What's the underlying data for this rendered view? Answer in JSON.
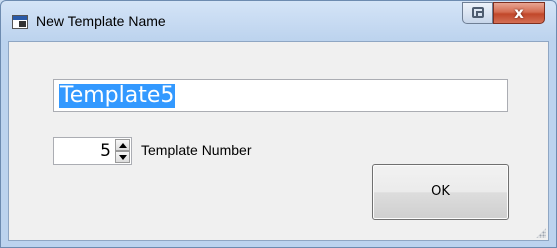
{
  "window": {
    "title": "New Template Name",
    "app_icon": "template-app-icon",
    "restore_icon": "restore-icon",
    "close_label": "x"
  },
  "form": {
    "template_name_value": "Template5",
    "template_number_value": "5",
    "template_number_label": "Template Number",
    "ok_label": "OK",
    "selection_color": "#3399ff"
  },
  "colors": {
    "close_button": "#c1472a",
    "frame": "#c9dcf2"
  }
}
